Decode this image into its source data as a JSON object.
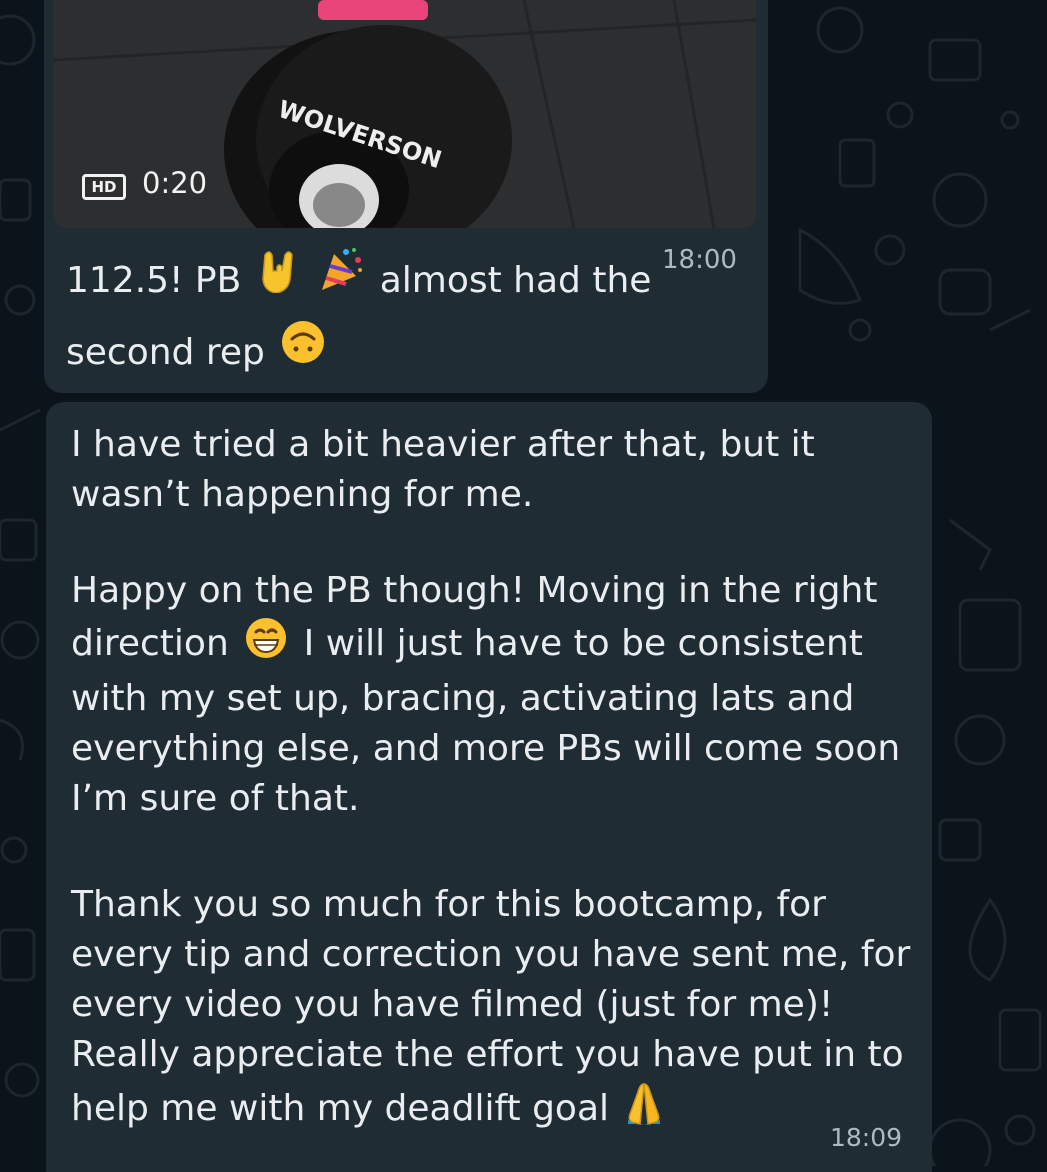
{
  "messages": [
    {
      "type": "video",
      "badge": "HD",
      "duration": "0:20",
      "plate_brand": "WOLVERSON",
      "caption_part1": "112.5! PB",
      "caption_part2": "almost had the",
      "caption_part3": "second rep",
      "emojis": [
        "sign-of-horns-icon",
        "party-popper-icon",
        "upside-down-face-icon"
      ],
      "time": "18:00"
    },
    {
      "type": "text",
      "paragraphs": [
        "I have tried a bit heavier after that, but  it wasn’t happening for me.",
        "Happy on the PB though! Moving in the right direction",
        "I will just have to be consistent with my set up, bracing, activating lats and everything else, and more PBs will come soon I’m sure of that.",
        "Thank you so much for this bootcamp, for every tip and correction you have sent me, for every video you have filmed (just for me)! Really appreciate the effort you have put in to help me with my deadlift goal"
      ],
      "emojis": [
        "grinning-face-icon",
        "folded-hands-icon"
      ],
      "time": "18:09"
    }
  ],
  "colors": {
    "background": "#0b141a",
    "bubble": "#1f2c34",
    "text": "#e9edef",
    "timestamp": "#aebac1"
  }
}
